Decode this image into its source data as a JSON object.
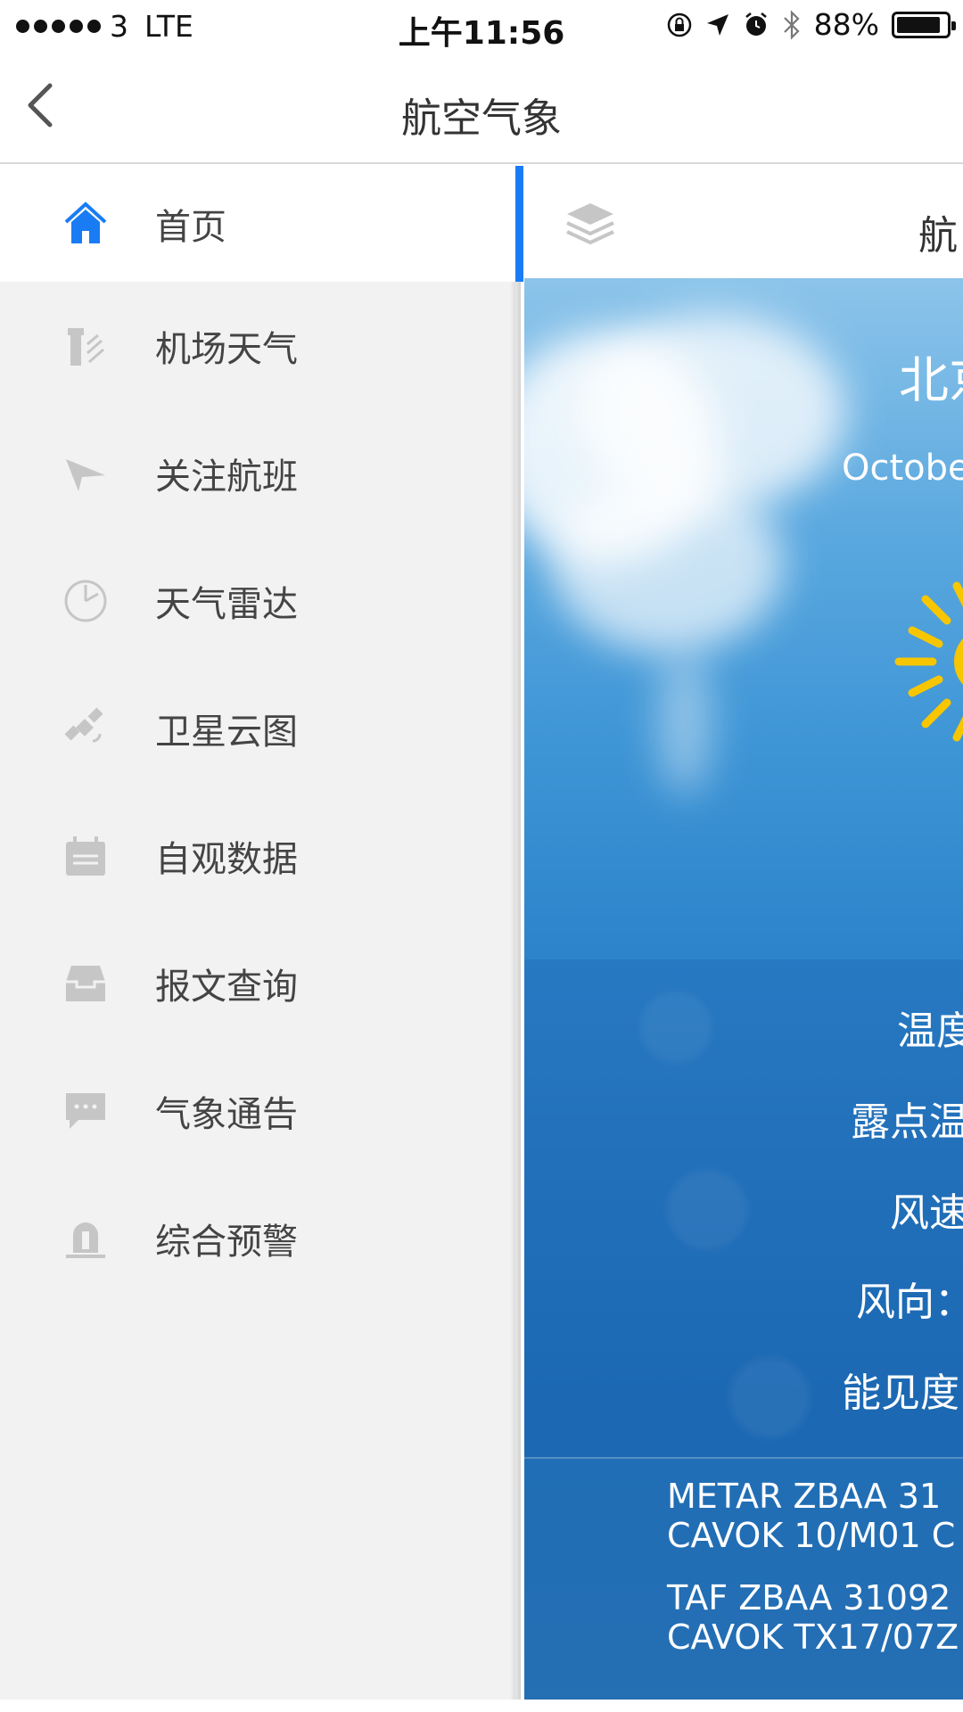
{
  "status_bar": {
    "carrier": "3",
    "network": "LTE",
    "time": "上午11:56",
    "battery_percent": "88%",
    "battery_level": 0.88,
    "icons": [
      "orientation-lock-icon",
      "location-arrow-icon",
      "alarm-icon",
      "bluetooth-icon",
      "battery-icon"
    ]
  },
  "nav": {
    "title": "航空气象",
    "back_icon": "chevron-left-icon"
  },
  "menu": {
    "items": [
      {
        "label": "首页",
        "icon": "home-icon",
        "active": true
      },
      {
        "label": "机场天气",
        "icon": "airport-weather-icon"
      },
      {
        "label": "关注航班",
        "icon": "paper-plane-icon"
      },
      {
        "label": "天气雷达",
        "icon": "radar-icon"
      },
      {
        "label": "卫星云图",
        "icon": "satellite-icon"
      },
      {
        "label": "自观数据",
        "icon": "calendar-data-icon"
      },
      {
        "label": "报文查询",
        "icon": "inbox-icon"
      },
      {
        "label": "气象通告",
        "icon": "chat-bubble-icon"
      },
      {
        "label": "综合预警",
        "icon": "warning-light-icon"
      }
    ]
  },
  "colors": {
    "accent": "#1a7cf5",
    "sun": "#f7c600"
  },
  "main": {
    "tab_text": "航",
    "city": "北京",
    "date": "Octobe",
    "info": {
      "temperature_label": "温度",
      "dewpoint_label": "露点温",
      "wind_speed_label": "风速",
      "wind_dir_label": "风向：",
      "visibility_label": "能见度"
    },
    "metar_line1": "METAR ZBAA 31",
    "metar_line2": "CAVOK 10/M01 C",
    "taf_line1": "TAF ZBAA 31092",
    "taf_line2": "CAVOK TX17/07Z"
  }
}
